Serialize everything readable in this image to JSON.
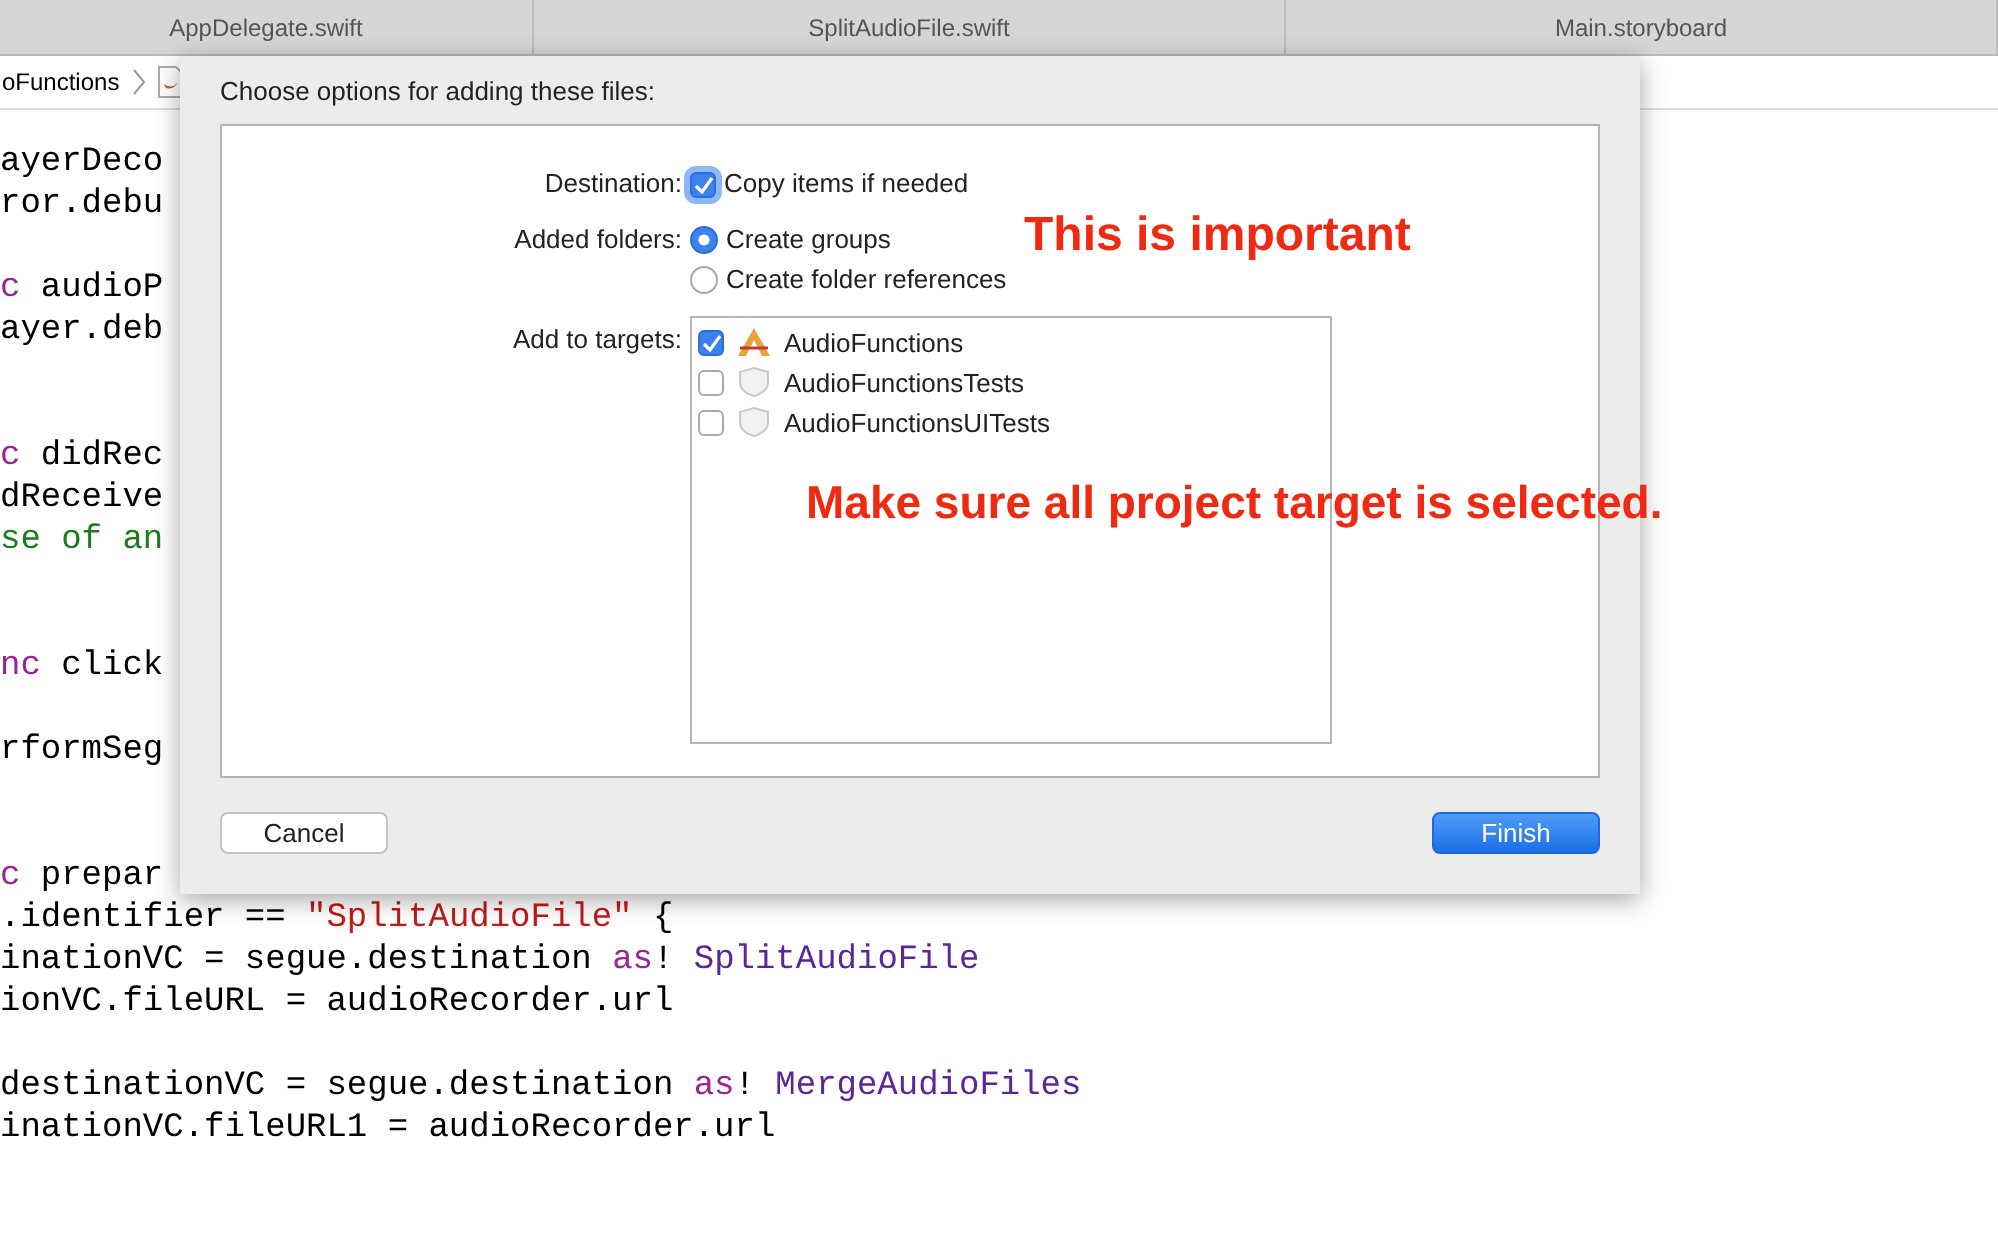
{
  "tabs": [
    {
      "label": "AppDelegate.swift",
      "selected": false
    },
    {
      "label": "SplitAudioFile.swift",
      "selected": false
    },
    {
      "label": "Main.storyboard",
      "selected": false
    }
  ],
  "breadcrumb": {
    "label": "oFunctions"
  },
  "code_lines": [
    {
      "kind": "code",
      "segments": [
        {
          "kind": "plain",
          "text": "ayerDeco"
        }
      ]
    },
    {
      "kind": "code",
      "segments": [
        {
          "kind": "plain",
          "text": "ror.debu"
        }
      ]
    },
    {
      "kind": "blank"
    },
    {
      "kind": "code",
      "segments": [
        {
          "kind": "keyword",
          "text": "c"
        },
        {
          "kind": "plain",
          "text": " audioP"
        }
      ]
    },
    {
      "kind": "code",
      "segments": [
        {
          "kind": "plain",
          "text": "ayer.deb"
        }
      ]
    },
    {
      "kind": "blank"
    },
    {
      "kind": "blank"
    },
    {
      "kind": "code",
      "segments": [
        {
          "kind": "keyword",
          "text": "c"
        },
        {
          "kind": "plain",
          "text": " didRec"
        }
      ]
    },
    {
      "kind": "code",
      "segments": [
        {
          "kind": "plain",
          "text": "dReceive"
        }
      ]
    },
    {
      "kind": "code",
      "segments": [
        {
          "kind": "comment",
          "text": "se of an"
        }
      ]
    },
    {
      "kind": "blank"
    },
    {
      "kind": "blank"
    },
    {
      "kind": "code",
      "segments": [
        {
          "kind": "keyword",
          "text": "nc"
        },
        {
          "kind": "plain",
          "text": " click"
        }
      ]
    },
    {
      "kind": "blank"
    },
    {
      "kind": "code",
      "segments": [
        {
          "kind": "plain",
          "text": "rformSeg"
        }
      ]
    },
    {
      "kind": "blank"
    },
    {
      "kind": "blank"
    },
    {
      "kind": "code",
      "segments": [
        {
          "kind": "keyword",
          "text": "c"
        },
        {
          "kind": "plain",
          "text": " prepar"
        }
      ]
    },
    {
      "kind": "code",
      "segments": [
        {
          "kind": "plain",
          "text": ".identifier == "
        },
        {
          "kind": "string",
          "text": "\"SplitAudioFile\""
        },
        {
          "kind": "plain",
          "text": " {"
        }
      ]
    },
    {
      "kind": "code",
      "segments": [
        {
          "kind": "plain",
          "text": "inationVC = segue.destination "
        },
        {
          "kind": "keyword",
          "text": "as"
        },
        {
          "kind": "plain",
          "text": "! "
        },
        {
          "kind": "type",
          "text": "SplitAudioFile"
        }
      ]
    },
    {
      "kind": "code",
      "segments": [
        {
          "kind": "plain",
          "text": "ionVC.fileURL = audioRecorder.url"
        }
      ]
    },
    {
      "kind": "blank"
    },
    {
      "kind": "code",
      "segments": [
        {
          "kind": "plain",
          "text": "destinationVC = segue.destination "
        },
        {
          "kind": "keyword",
          "text": "as"
        },
        {
          "kind": "plain",
          "text": "! "
        },
        {
          "kind": "type",
          "text": "MergeAudioFiles"
        }
      ]
    },
    {
      "kind": "code",
      "segments": [
        {
          "kind": "plain",
          "text": "inationVC.fileURL1 = audioRecorder.url"
        }
      ]
    }
  ],
  "dialog": {
    "title": "Choose options for adding these files:",
    "destination": {
      "label": "Destination:",
      "option": "Copy items if needed",
      "checked": true
    },
    "added_folders": {
      "label": "Added folders:",
      "options": [
        {
          "label": "Create groups",
          "selected": true
        },
        {
          "label": "Create folder references",
          "selected": false
        }
      ]
    },
    "targets": {
      "label": "Add to targets:",
      "items": [
        {
          "label": "AudioFunctions",
          "kind": "app",
          "checked": true
        },
        {
          "label": "AudioFunctionsTests",
          "kind": "test",
          "checked": false
        },
        {
          "label": "AudioFunctionsUITests",
          "kind": "test",
          "checked": false
        }
      ]
    },
    "annotations": [
      "This is important",
      "Make sure all project target is selected."
    ],
    "cancel_button": "Cancel",
    "finish_button": "Finish"
  }
}
